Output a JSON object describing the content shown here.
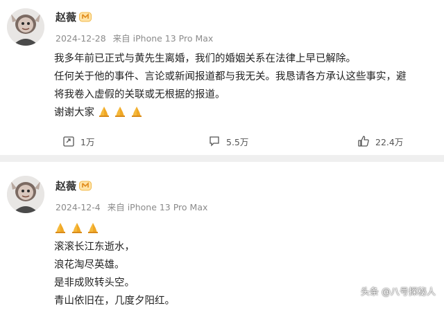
{
  "post1": {
    "author": "赵薇",
    "date": "2024-12-28",
    "source_prefix": "来自",
    "device": "iPhone 13 Pro Max",
    "lines": [
      "我多年前已正式与黄先生离婚，我们的婚姻关系在法律上早已解除。",
      "任何关于他的事件、言论或新闻报道都与我无关。我恳请各方承认这些事实，避",
      "将我卷入虚假的关联或无根据的报道。",
      "谢谢大家"
    ],
    "emoji": "pray-emoji",
    "actions": {
      "share": "1万",
      "comment": "5.5万",
      "like": "22.4万"
    }
  },
  "post2": {
    "author": "赵薇",
    "date": "2024-12-4",
    "source_prefix": "来自",
    "device": "iPhone 13 Pro Max",
    "lines": [
      "滚滚长江东逝水，",
      "浪花淘尽英雄。",
      "是非成败转头空。",
      "青山依旧在，几度夕阳红。"
    ]
  },
  "watermark": "头条 @八号探秘人",
  "colors": {
    "meta": "#8a8a8a",
    "text": "#222222",
    "divider": "#efefef"
  }
}
